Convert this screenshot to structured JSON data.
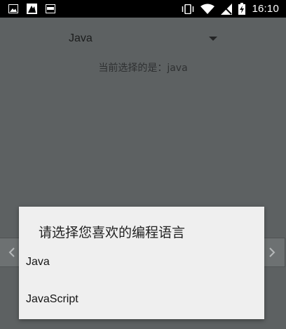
{
  "status_bar": {
    "time": "16:10",
    "left_icons": [
      "image-icon",
      "transfer-icon",
      "ftp-icon"
    ],
    "right_icons": [
      "vibrate-icon",
      "wifi-icon",
      "no-signal-icon",
      "battery-charging-icon"
    ]
  },
  "spinner": {
    "selected_value": "Java"
  },
  "selection_text": "当前选择的是：java",
  "dialog": {
    "title": "请选择您喜欢的编程语言",
    "options": [
      "Java",
      "JavaScript"
    ]
  },
  "colors": {
    "status_bar_bg": "#000000",
    "dim_background": "#5d6162",
    "dialog_bg": "#efefef"
  }
}
